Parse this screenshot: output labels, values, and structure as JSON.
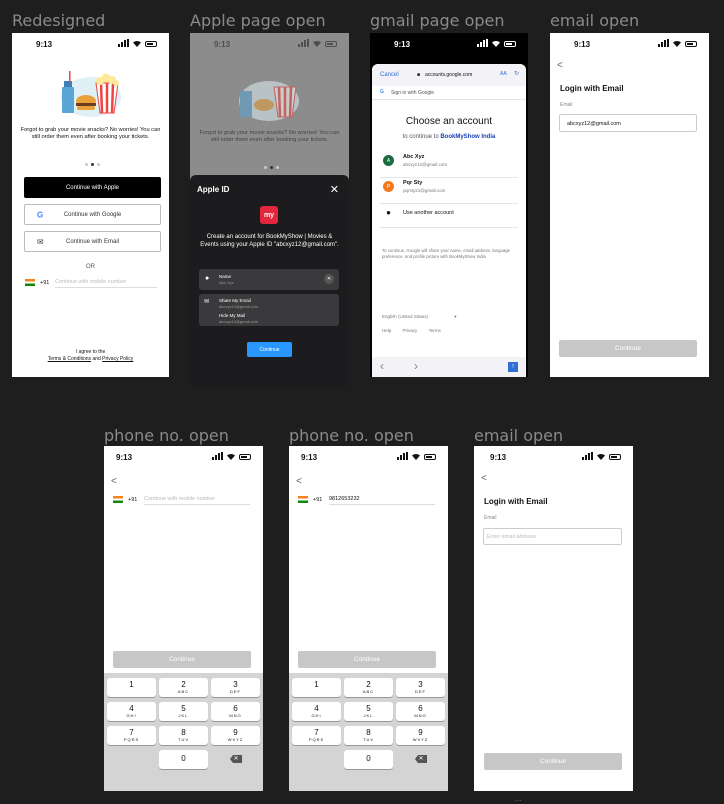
{
  "labels": [
    "Redesigned",
    "Apple page open",
    "gmail page open",
    "email open",
    "phone no. open",
    "phone no. open",
    "email open"
  ],
  "status_time": "9:13",
  "onboard": {
    "tagline": "Forgot to grab your movie snacks? No worries! You can still order them even after booking your tickets.",
    "apple": "Continue with Apple",
    "google": "Continue with Google",
    "email": "Continue with Email",
    "or": "OR",
    "code": "+91",
    "phone_placeholder": "Continue with mobile number",
    "agree": "I agree to the",
    "terms": "Terms & Conditions",
    "and": "and",
    "privacy": "Privacy Policy"
  },
  "apple_sheet": {
    "title": "Apple ID",
    "close": "✕",
    "message": "Create an account for BookMyShow | Movies & Events using your Apple ID \"abcxyz12@gmail.com\".",
    "name_label": "Name",
    "name_value": "Abc Xyz",
    "share_label": "Share My Email",
    "share_value": "abcxyz12@gmail.com",
    "hide_label": "Hide My Mail",
    "hide_value": "abcxyz12@gmail.com",
    "continue": "Continue"
  },
  "gmail": {
    "cancel": "Cancel",
    "url": "accounts.google.com",
    "aa": "AA",
    "signin": "Sign in with Google",
    "title": "Choose an account",
    "continue_to": "to continue to",
    "app": "BookMyShow India",
    "accounts": [
      {
        "initial": "A",
        "name": "Abc Xyz",
        "email": "abcxyz12@gmail.com",
        "color": "#1a6b3f"
      },
      {
        "initial": "P",
        "name": "Pqr Sty",
        "email": "pqrsty21@gmail.com",
        "color": "#f07b1f"
      }
    ],
    "another": "Use another account",
    "disclaimer": "To continue, Google will share your name, email address, language preference, and profile picture with BookMyShow India",
    "language": "English (United States)",
    "help": "Help",
    "privacy": "Privacy",
    "terms": "Terms"
  },
  "email_login": {
    "back": "<",
    "title": "Login with Email",
    "field_label": "Email",
    "filled_value": "abcxyz12@gmail.com",
    "placeholder": "Enter email address",
    "continue": "Continue"
  },
  "phone": {
    "back": "<",
    "code": "+91",
    "placeholder": "Continue with mobile number",
    "entered": "9812653232",
    "continue": "Continue"
  },
  "keypad": [
    {
      "n": "1",
      "l": ""
    },
    {
      "n": "2",
      "l": "ABC"
    },
    {
      "n": "3",
      "l": "DEF"
    },
    {
      "n": "4",
      "l": "GHI"
    },
    {
      "n": "5",
      "l": "JKL"
    },
    {
      "n": "6",
      "l": "MNO"
    },
    {
      "n": "7",
      "l": "PQRS"
    },
    {
      "n": "8",
      "l": "TUV"
    },
    {
      "n": "9",
      "l": "WXYZ"
    },
    {
      "n": "0",
      "l": ""
    }
  ],
  "footer_dots": "..."
}
